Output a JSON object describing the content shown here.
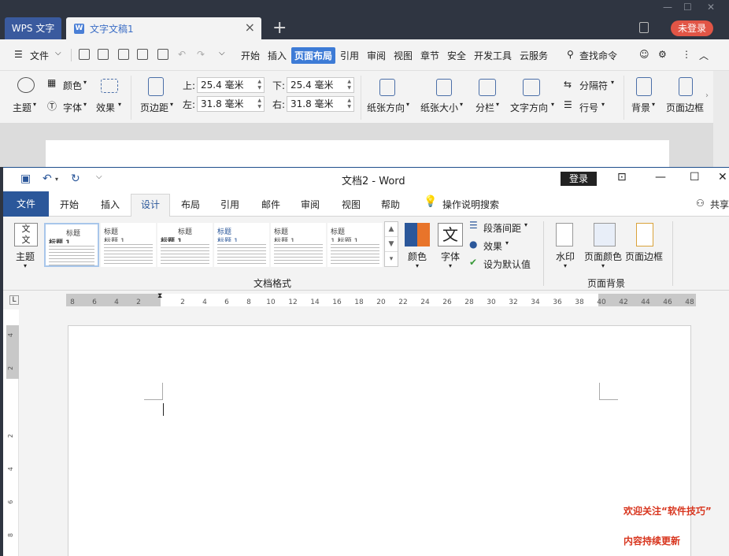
{
  "wps": {
    "app_tab": "WPS 文字",
    "doc_tab": "文字文稿1",
    "login": "未登录",
    "menu": {
      "file": "文件",
      "items": [
        "开始",
        "插入",
        "页面布局",
        "引用",
        "审阅",
        "视图",
        "章节",
        "安全",
        "开发工具",
        "云服务"
      ],
      "active": "页面布局",
      "search": "查找命令"
    },
    "ribbon": {
      "color": "颜色",
      "theme": "主题",
      "font": "字体",
      "effects": "效果",
      "margins": "页边距",
      "top_label": "上:",
      "bottom_label": "下:",
      "left_label": "左:",
      "right_label": "右:",
      "top_value": "25.4 毫米",
      "bottom_value": "25.4 毫米",
      "left_value": "31.8 毫米",
      "right_value": "31.8 毫米",
      "orientation": "纸张方向",
      "size": "纸张大小",
      "columns": "分栏",
      "text_direction": "文字方向",
      "breaks": "分隔符",
      "line_numbers": "行号",
      "background": "背景",
      "page_border": "页面边框"
    }
  },
  "word": {
    "title": "文档2  -  Word",
    "login": "登录",
    "tabs": {
      "file": "文件",
      "items": [
        "开始",
        "插入",
        "设计",
        "布局",
        "引用",
        "邮件",
        "审阅",
        "视图",
        "帮助"
      ],
      "active": "设计",
      "tell_me": "操作说明搜索",
      "share": "共享"
    },
    "ribbon": {
      "theme": "主题",
      "style_titles": [
        "标题",
        "标题",
        "标题",
        "标题",
        "标题",
        "标题"
      ],
      "style_subtitles": [
        "标题 1",
        "标题 1",
        "标题 1",
        "标题 1",
        "标题 1",
        "1  标题 1"
      ],
      "colors": "颜色",
      "fonts": "字体",
      "paragraph_spacing": "段落间距",
      "effects": "效果",
      "set_default": "设为默认值",
      "group_doc_format": "文档格式",
      "watermark": "水印",
      "page_color": "页面颜色",
      "page_borders": "页面边框",
      "group_page_background": "页面背景"
    },
    "ruler": {
      "left_numbers": [
        "8",
        "6",
        "4",
        "2"
      ],
      "right_numbers": [
        "2",
        "4",
        "6",
        "8",
        "10",
        "12",
        "14",
        "16",
        "18",
        "20",
        "22",
        "24",
        "26",
        "28",
        "30",
        "32",
        "34",
        "36",
        "38",
        "40",
        "42",
        "44",
        "46",
        "48"
      ],
      "vertical_numbers": [
        "4",
        "2",
        "2",
        "4",
        "6",
        "8"
      ]
    }
  },
  "overlay": {
    "line1": "欢迎关注“软件技巧”",
    "line2": "内容持续更新"
  },
  "colors": {
    "wps_dark": "#2f3541",
    "wps_active": "#3d7bd6",
    "wps_login": "#e15546",
    "word_blue": "#2b579a",
    "watermark_red": "#d8351e"
  }
}
